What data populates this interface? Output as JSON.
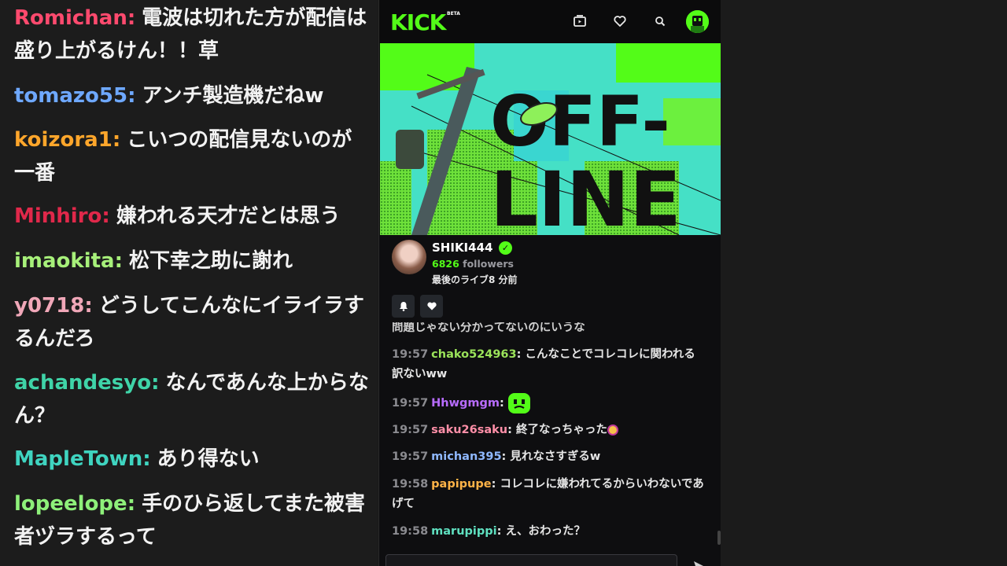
{
  "overlay_chat": [
    {
      "user": "Romichan",
      "color": "#ff4a6e",
      "text": "電波は切れた方が配信は盛り上がるけん！！草"
    },
    {
      "user": "tomazo55",
      "color": "#6ea8ff",
      "text": "アンチ製造機だねw"
    },
    {
      "user": "koizora1",
      "color": "#ffa62b",
      "text": "こいつの配信見ないのが　一番"
    },
    {
      "user": "Minhiro",
      "color": "#e0284a",
      "text": "嫌われる天才だとは思う"
    },
    {
      "user": "imaokita",
      "color": "#a7f07a",
      "text": "松下幸之助に謝れ"
    },
    {
      "user": "y0718",
      "color": "#f0a7b8",
      "text": "どうしてこんなにイライラするんだろ"
    },
    {
      "user": "achandesyo",
      "color": "#3fd4a8",
      "text": "なんであんな上からなん？"
    },
    {
      "user": "MapleTown",
      "color": "#3fd4c0",
      "text": "あり得ない"
    },
    {
      "user": "lopeelope",
      "color": "#8ef07a",
      "text": "手のひら返してまた被害者ヅラするって"
    }
  ],
  "kick": {
    "logo": "KICK",
    "beta": "BETA",
    "nav_icons": [
      "clips-icon",
      "heart-icon",
      "search-icon",
      "user-avatar"
    ],
    "banner_text_top": "OFF-",
    "banner_text_bottom": "LINE",
    "channel": {
      "name": "SHIKI444",
      "followers_count": "6826",
      "followers_label": "followers",
      "last_live": "最後のライブ8 分前"
    },
    "chat_partial": "問題じゃない分かってないのにいうな",
    "chat": [
      {
        "time": "19:57",
        "user": "chako524963",
        "color": "#9be35a",
        "text": "こんなことでコレコレに関われる訳ないww"
      },
      {
        "time": "19:57",
        "user": "Hhwgmgm",
        "color": "#b86cff",
        "text": "",
        "emote": true
      },
      {
        "time": "19:57",
        "user": "saku26saku",
        "color": "#ff8fa8",
        "text": "終了なっちゃった",
        "emoji": true
      },
      {
        "time": "19:57",
        "user": "michan395",
        "color": "#8fb8ff",
        "text": "見れなさすぎるw"
      },
      {
        "time": "19:58",
        "user": "papipupe",
        "color": "#ffb347",
        "text": "コレコレに嫌われてるからいわないであげて"
      },
      {
        "time": "19:58",
        "user": "marupippi",
        "color": "#5fe0c0",
        "text": "え、おわった？"
      }
    ]
  },
  "colors": {
    "kick_green": "#53fc18",
    "panel_bg": "#0e0e10"
  }
}
